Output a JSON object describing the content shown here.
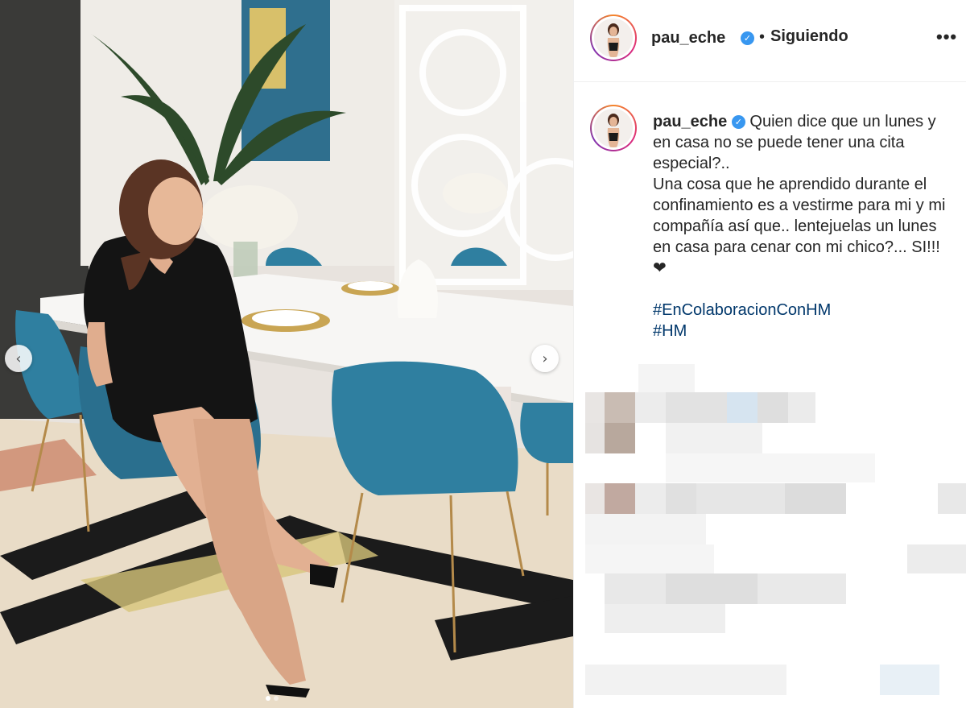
{
  "post": {
    "username": "pau_eche",
    "verified_icon": "verified-badge-icon",
    "separator": "•",
    "follow_status": "Siguiendo",
    "more_label": "•••"
  },
  "caption": {
    "username": "pau_eche",
    "line_first": "Quien dice que un lunes y en casa no se puede tener una cita especial?..",
    "line_second": "Una cosa que he aprendido durante el confinamiento es a vestirme para mi y mi compañía así que.. lentejuelas un lunes en casa para cenar con mi chico?... SI!!! ❤",
    "hashtags": [
      "#EnColaboracionConHM",
      "#HM"
    ]
  },
  "carousel": {
    "prev_icon": "chevron-left-icon",
    "next_icon": "chevron-right-icon",
    "prev_glyph": "‹",
    "next_glyph": "›"
  },
  "colors": {
    "accent_link": "#00376b",
    "verified": "#3897f0",
    "chair_velvet": "#2f7fa0"
  }
}
